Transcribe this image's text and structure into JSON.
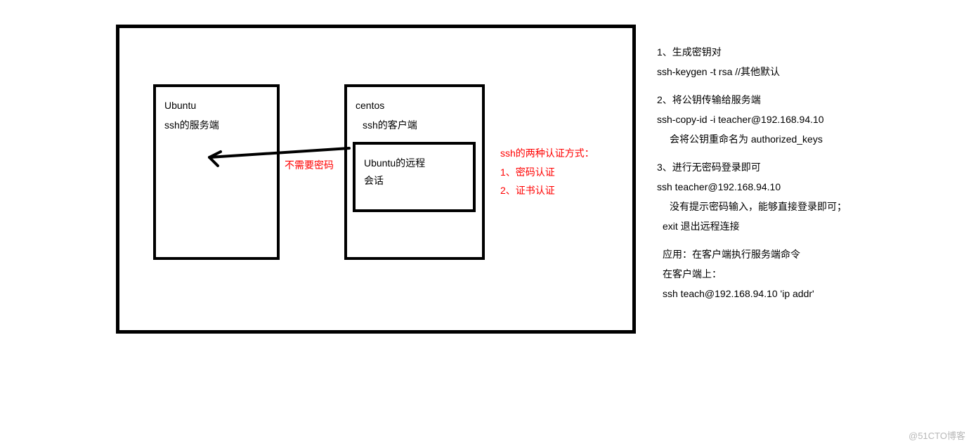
{
  "diagram": {
    "ubuntu": {
      "title": "Ubuntu",
      "role": "ssh的服务端"
    },
    "centos": {
      "title": "centos",
      "role": "ssh的客户端"
    },
    "session": {
      "line1": "Ubuntu的远程",
      "line2": "会话"
    },
    "no_password": "不需要密码",
    "auth_methods": {
      "heading": "ssh的两种认证方式：",
      "item1": "1、密码认证",
      "item2": "2、证书认证"
    }
  },
  "steps": {
    "s1_title": "1、生成密钥对",
    "s1_cmd": "ssh-keygen -t rsa   //其他默认",
    "s2_title": "2、将公钥传输给服务端",
    "s2_cmd": "ssh-copy-id  -i teacher@192.168.94.10",
    "s2_note": "会将公钥重命名为 authorized_keys",
    "s3_title": "3、进行无密码登录即可",
    "s3_cmd": "ssh teacher@192.168.94.10",
    "s3_note": "没有提示密码输入，能够直接登录即可；",
    "s3_exit": "exit 退出远程连接",
    "app_title": "应用：在客户端执行服务端命令",
    "app_where": "在客户端上：",
    "app_cmd": "ssh teach@192.168.94.10 'ip addr'"
  },
  "watermark": "@51CTO博客"
}
